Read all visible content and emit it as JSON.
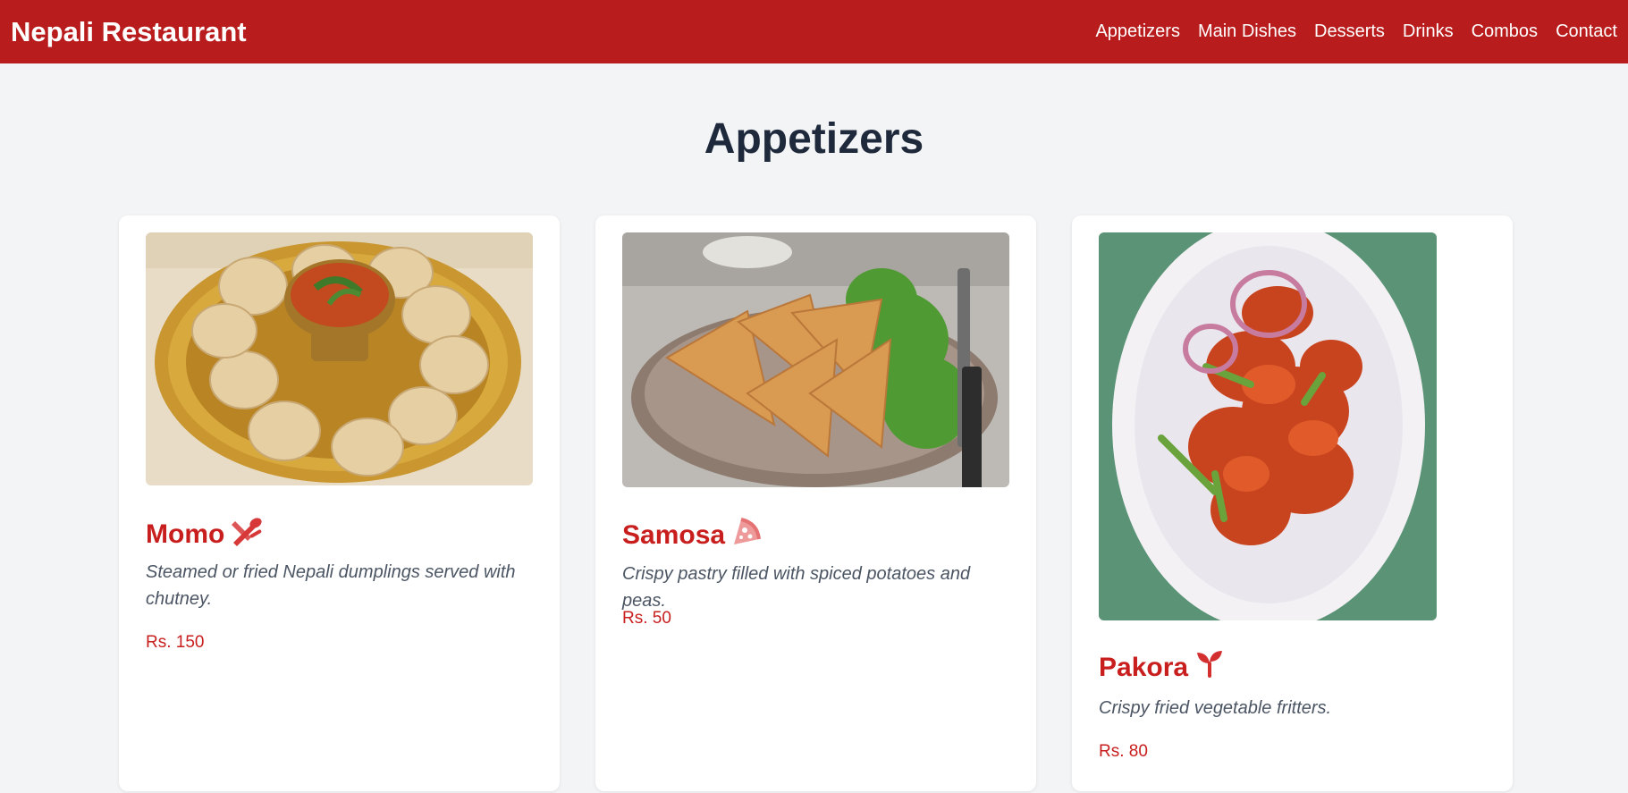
{
  "header": {
    "brand": "Nepali Restaurant",
    "nav": [
      "Appetizers",
      "Main Dishes",
      "Desserts",
      "Drinks",
      "Combos",
      "Contact"
    ]
  },
  "section": {
    "title": "Appetizers"
  },
  "items": [
    {
      "name": "Momo",
      "icon": "utensils-icon",
      "description": "Steamed or fried Nepali dumplings served with chutney.",
      "price": "Rs. 150"
    },
    {
      "name": "Samosa",
      "icon": "pizza-slice-icon",
      "description": "Crispy pastry filled with spiced potatoes and peas.",
      "price": "Rs. 50"
    },
    {
      "name": "Pakora",
      "icon": "seedling-icon",
      "description": "Crispy fried vegetable fritters.",
      "price": "Rs. 80"
    }
  ],
  "colors": {
    "header_bg": "#b91c1c",
    "accent": "#c81e1e",
    "page_bg": "#f3f4f6"
  }
}
